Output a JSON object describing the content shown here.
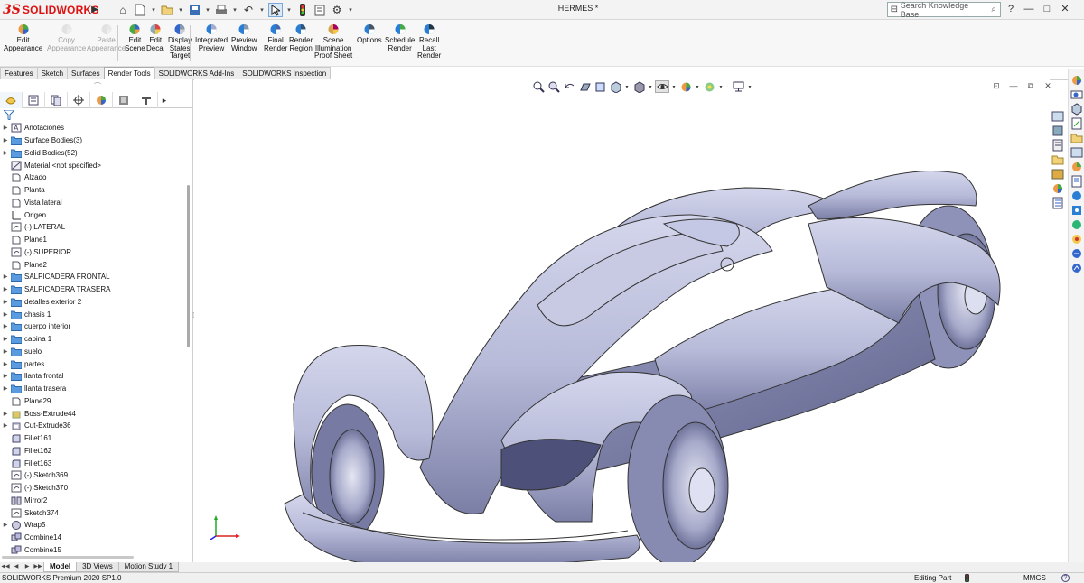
{
  "titlebar": {
    "logo_ds": "3S",
    "logo_text": "SOLIDWORKS",
    "document_title": "HERMES *",
    "search_placeholder": "Search Knowledge Base",
    "help_label": "?",
    "window_buttons": [
      "—",
      "□",
      "✕"
    ]
  },
  "commands": [
    {
      "label": "Edit Appearance",
      "lines": [
        "Edit",
        "Appearance"
      ],
      "enabled": true
    },
    {
      "label": "Copy Appearance",
      "lines": [
        "Copy",
        "Appearance"
      ],
      "enabled": false
    },
    {
      "label": "Paste Appearance",
      "lines": [
        "Paste",
        "Appearance"
      ],
      "enabled": false
    },
    {
      "label": "Edit Scene",
      "lines": [
        "Edit",
        "Scene"
      ],
      "enabled": true
    },
    {
      "label": "Edit Decal",
      "lines": [
        "Edit",
        "Decal"
      ],
      "enabled": true
    },
    {
      "label": "Display States Target",
      "lines": [
        "Display",
        "States",
        "Target"
      ],
      "enabled": true
    },
    {
      "label": "Integrated Preview",
      "lines": [
        "Integrated",
        "Preview"
      ],
      "enabled": true
    },
    {
      "label": "Preview Window",
      "lines": [
        "Preview",
        "Window"
      ],
      "enabled": true
    },
    {
      "label": "Final Render",
      "lines": [
        "Final",
        "Render"
      ],
      "enabled": true
    },
    {
      "label": "Render Region",
      "lines": [
        "Render",
        "Region"
      ],
      "enabled": true
    },
    {
      "label": "Scene Illumination Proof Sheet",
      "lines": [
        "Scene",
        "Illumination",
        "Proof Sheet"
      ],
      "enabled": true
    },
    {
      "label": "Options",
      "lines": [
        "Options"
      ],
      "enabled": true
    },
    {
      "label": "Schedule Render",
      "lines": [
        "Schedule",
        "Render"
      ],
      "enabled": true
    },
    {
      "label": "Recall Last Render",
      "lines": [
        "Recall",
        "Last",
        "Render"
      ],
      "enabled": true
    }
  ],
  "command_tabs": [
    "Features",
    "Sketch",
    "Surfaces",
    "Render Tools",
    "SOLIDWORKS Add-Ins",
    "SOLIDWORKS Inspection"
  ],
  "active_command_tab": "Render Tools",
  "feature_tree": [
    {
      "label": "Anotaciones",
      "icon": "annotations-icon",
      "expandable": true
    },
    {
      "label": "Surface Bodies(3)",
      "icon": "folder-icon",
      "expandable": true
    },
    {
      "label": "Solid Bodies(52)",
      "icon": "folder-icon",
      "expandable": true
    },
    {
      "label": "Material <not specified>",
      "icon": "material-icon",
      "expandable": false
    },
    {
      "label": "Alzado",
      "icon": "plane-icon",
      "expandable": false
    },
    {
      "label": "Planta",
      "icon": "plane-icon",
      "expandable": false
    },
    {
      "label": "Vista lateral",
      "icon": "plane-icon",
      "expandable": false
    },
    {
      "label": "Origen",
      "icon": "origin-icon",
      "expandable": false
    },
    {
      "label": "(-) LATERAL",
      "icon": "sketch-icon",
      "expandable": false
    },
    {
      "label": "Plane1",
      "icon": "plane-icon",
      "expandable": false
    },
    {
      "label": "(-) SUPERIOR",
      "icon": "sketch-icon",
      "expandable": false
    },
    {
      "label": "Plane2",
      "icon": "plane-icon",
      "expandable": false
    },
    {
      "label": "SALPICADERA FRONTAL",
      "icon": "folder-icon",
      "expandable": true
    },
    {
      "label": "SALPICADERA TRASERA",
      "icon": "folder-icon",
      "expandable": true
    },
    {
      "label": "detalles exterior 2",
      "icon": "folder-icon",
      "expandable": true
    },
    {
      "label": "chasis 1",
      "icon": "folder-icon",
      "expandable": true
    },
    {
      "label": "cuerpo interior",
      "icon": "folder-icon",
      "expandable": true
    },
    {
      "label": "cabina 1",
      "icon": "folder-icon",
      "expandable": true
    },
    {
      "label": "suelo",
      "icon": "folder-icon",
      "expandable": true
    },
    {
      "label": "partes",
      "icon": "folder-icon",
      "expandable": true
    },
    {
      "label": "llanta frontal",
      "icon": "folder-icon",
      "expandable": true
    },
    {
      "label": "llanta trasera",
      "icon": "folder-icon",
      "expandable": true
    },
    {
      "label": "Plane29",
      "icon": "plane-icon",
      "expandable": false
    },
    {
      "label": "Boss-Extrude44",
      "icon": "extrude-icon",
      "expandable": true
    },
    {
      "label": "Cut-Extrude36",
      "icon": "cut-extrude-icon",
      "expandable": true
    },
    {
      "label": "Fillet161",
      "icon": "fillet-icon",
      "expandable": false
    },
    {
      "label": "Fillet162",
      "icon": "fillet-icon",
      "expandable": false
    },
    {
      "label": "Fillet163",
      "icon": "fillet-icon",
      "expandable": false
    },
    {
      "label": "(-) Sketch369",
      "icon": "sketch-icon",
      "expandable": false
    },
    {
      "label": "(-) Sketch370",
      "icon": "sketch-icon",
      "expandable": false
    },
    {
      "label": "Mirror2",
      "icon": "mirror-icon",
      "expandable": false
    },
    {
      "label": "Sketch374",
      "icon": "sketch-icon",
      "expandable": false
    },
    {
      "label": "Wrap5",
      "icon": "wrap-icon",
      "expandable": true
    },
    {
      "label": "Combine14",
      "icon": "combine-icon",
      "expandable": false
    },
    {
      "label": "Combine15",
      "icon": "combine-icon",
      "expandable": false
    }
  ],
  "bottom_tabs": [
    "Model",
    "3D Views",
    "Motion Study 1"
  ],
  "active_bottom_tab": "Model",
  "status": {
    "product": "SOLIDWORKS Premium 2020 SP1.0",
    "mode": "Editing Part",
    "units": "MMGS",
    "help": "?"
  },
  "colors": {
    "brand": "#d11b1b",
    "car_body": "#b9bcd9",
    "folder": "#4a90d9",
    "selection": "#dbe8f6"
  }
}
